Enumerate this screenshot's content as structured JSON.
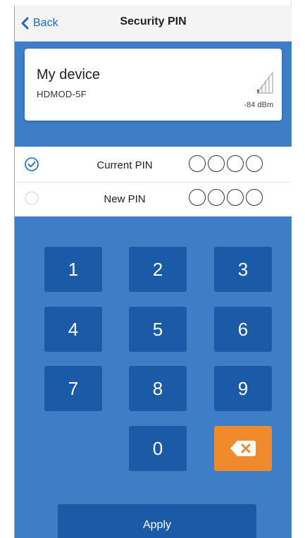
{
  "header": {
    "back_label": "Back",
    "title": "Security PIN"
  },
  "device": {
    "name": "My device",
    "id": "HDMOD-5F",
    "signal": "-84 dBm"
  },
  "pin_rows": [
    {
      "label": "Current PIN",
      "checked": true,
      "filled": 0,
      "length": 4
    },
    {
      "label": "New PIN",
      "checked": false,
      "filled": 0,
      "length": 4
    }
  ],
  "keypad": {
    "keys": [
      "1",
      "2",
      "3",
      "4",
      "5",
      "6",
      "7",
      "8",
      "9",
      "0"
    ],
    "delete_icon": "backspace-icon",
    "apply_label": "Apply"
  },
  "colors": {
    "background": "#3d7ec6",
    "key": "#1a5aa6",
    "delete_key": "#f08a2c",
    "link": "#1b66c9"
  },
  "icons": {
    "back": "chevron-left-icon",
    "signal": "signal-strength-icon",
    "check": "check-circle-icon"
  }
}
